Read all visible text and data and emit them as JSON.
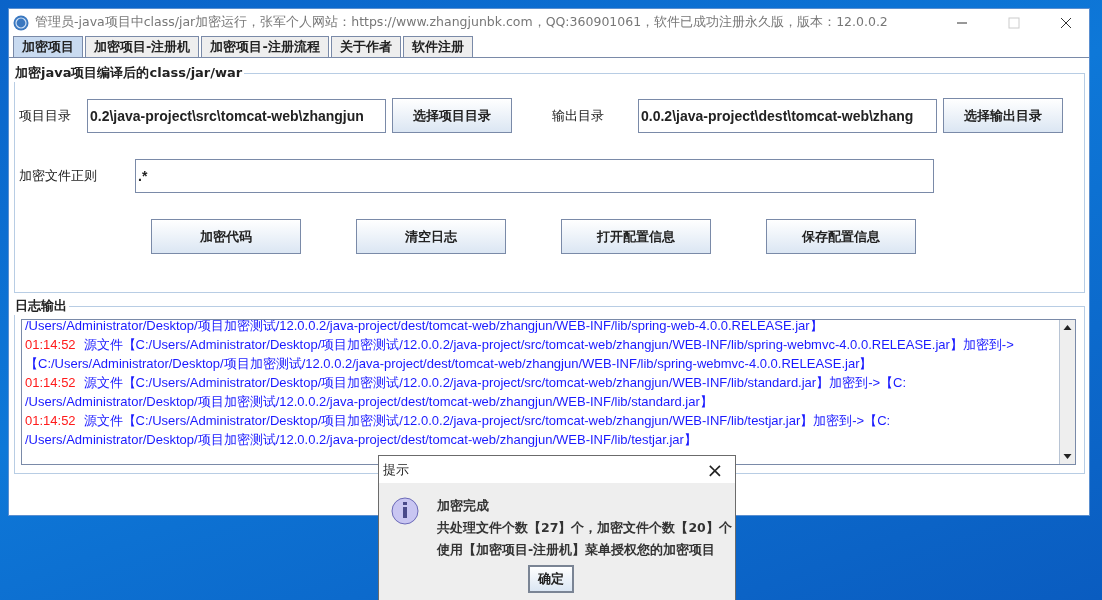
{
  "window": {
    "title": "管理员-java项目中class/jar加密运行，张军个人网站：https://www.zhangjunbk.com，QQ:360901061，软件已成功注册永久版，版本：12.0.0.2"
  },
  "tabs": [
    {
      "label": "加密项目",
      "selected": true
    },
    {
      "label": "加密项目-注册机",
      "selected": false
    },
    {
      "label": "加密项目-注册流程",
      "selected": false
    },
    {
      "label": "关于作者",
      "selected": false
    },
    {
      "label": "软件注册",
      "selected": false
    }
  ],
  "settings": {
    "title": "加密java项目编译后的class/jar/war",
    "project_dir": {
      "label": "项目目录",
      "value": "0.2\\java-project\\src\\tomcat-web\\zhangjun",
      "button": "选择项目目录"
    },
    "output_dir": {
      "label": "输出目录",
      "value": "0.0.2\\java-project\\dest\\tomcat-web\\zhang",
      "button": "选择输出目录"
    },
    "pattern": {
      "label": "加密文件正则",
      "value": ".*"
    },
    "buttons": [
      "加密代码",
      "清空日志",
      "打开配置信息",
      "保存配置信息"
    ]
  },
  "log": {
    "title": "日志输出",
    "lines": [
      {
        "text": "/Users/Administrator/Desktop/项目加密测试/12.0.0.2/java-project/dest/tomcat-web/zhangjun/WEB-INF/lib/spring-web-4.0.0.RELEASE.jar】"
      },
      {
        "time": "01:14:52",
        "text": "源文件【C:/Users/Administrator/Desktop/项目加密测试/12.0.0.2/java-project/src/tomcat-web/zhangjun/WEB-INF/lib/spring-webmvc-4.0.0.RELEASE.jar】加密到->"
      },
      {
        "text": "【C:/Users/Administrator/Desktop/项目加密测试/12.0.0.2/java-project/dest/tomcat-web/zhangjun/WEB-INF/lib/spring-webmvc-4.0.0.RELEASE.jar】"
      },
      {
        "time": "01:14:52",
        "text": "源文件【C:/Users/Administrator/Desktop/项目加密测试/12.0.0.2/java-project/src/tomcat-web/zhangjun/WEB-INF/lib/standard.jar】加密到->【C:"
      },
      {
        "text": "/Users/Administrator/Desktop/项目加密测试/12.0.0.2/java-project/dest/tomcat-web/zhangjun/WEB-INF/lib/standard.jar】"
      },
      {
        "time": "01:14:52",
        "text": "源文件【C:/Users/Administrator/Desktop/项目加密测试/12.0.0.2/java-project/src/tomcat-web/zhangjun/WEB-INF/lib/testjar.jar】加密到->【C:"
      },
      {
        "text": "/Users/Administrator/Desktop/项目加密测试/12.0.0.2/java-project/dest/tomcat-web/zhangjun/WEB-INF/lib/testjar.jar】"
      }
    ]
  },
  "dialog": {
    "title": "提示",
    "close": "×",
    "lines": [
      "加密完成",
      "共处理文件个数【27】个，加密文件个数【20】个",
      "使用【加密项目-注册机】菜单授权您的加密项目"
    ],
    "button": "确定"
  }
}
